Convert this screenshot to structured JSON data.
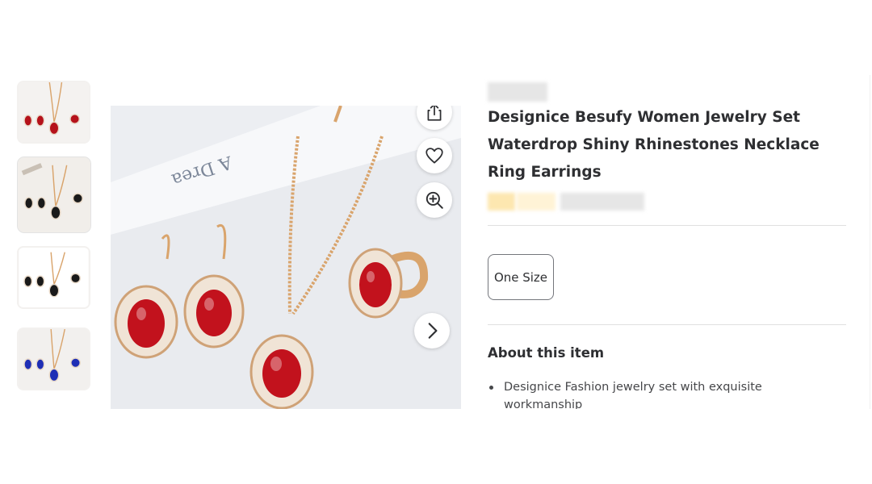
{
  "product": {
    "title": "Designice Besufy Women Jewelry Set Waterdrop Shiny Rhinestones Necklace Ring Earrings"
  },
  "gallery": {
    "thumbnails": [
      {
        "stone_color": "#b5121b"
      },
      {
        "stone_color": "#1a1a1a"
      },
      {
        "stone_color": "#1a1a1a"
      },
      {
        "stone_color": "#1f2fb5"
      }
    ],
    "main_stone_color": "#c2121d",
    "decor_text": "A Drea"
  },
  "actions": {
    "share_icon": "share-icon",
    "favorite_icon": "heart-icon",
    "zoom_icon": "zoom-in-icon",
    "next_icon": "chevron-right-icon"
  },
  "options": {
    "size_label": "One Size"
  },
  "about": {
    "heading": "About this item",
    "bullets": [
      "Designice Fashion jewelry set with exquisite workmanship"
    ]
  },
  "colors": {
    "text": "#2e2f32",
    "divider": "#e0e0e0",
    "gold": "#d9a46c",
    "rating_star": "#ffc220"
  }
}
